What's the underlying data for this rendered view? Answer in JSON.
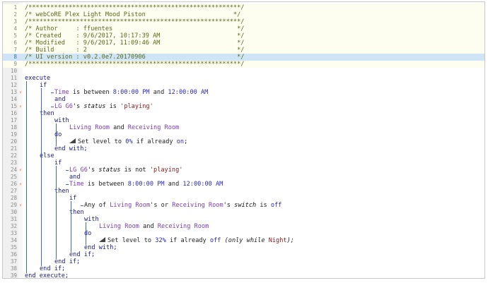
{
  "editor": {
    "highlighted_line": "8",
    "lines": [
      {
        "n": "1",
        "tokens": [
          {
            "t": "/**********************************************************/",
            "c": "c-comment"
          }
        ]
      },
      {
        "n": "2",
        "tokens": [
          {
            "t": "/* webCoRE Plex Light Mood Piston                        */",
            "c": "c-comment"
          }
        ]
      },
      {
        "n": "3",
        "tokens": [
          {
            "t": "/**********************************************************/",
            "c": "c-comment"
          }
        ]
      },
      {
        "n": "4",
        "tokens": [
          {
            "t": "/* Author     : ffuentes                                  */",
            "c": "c-comment"
          }
        ]
      },
      {
        "n": "5",
        "tokens": [
          {
            "t": "/* Created    : 9/6/2017, 10:17:39 AM                     */",
            "c": "c-comment"
          }
        ]
      },
      {
        "n": "6",
        "tokens": [
          {
            "t": "/* Modified   : 9/6/2017, 11:09:46 AM                     */",
            "c": "c-comment"
          }
        ]
      },
      {
        "n": "7",
        "tokens": [
          {
            "t": "/* Build      : 2                                         */",
            "c": "c-comment"
          }
        ]
      },
      {
        "n": "8",
        "tokens": [
          {
            "t": "/* UI version : v0.2.0e7.20170906                         */",
            "c": "c-comment"
          }
        ]
      },
      {
        "n": "9",
        "tokens": [
          {
            "t": "/**********************************************************/",
            "c": "c-comment"
          }
        ]
      },
      {
        "n": "10",
        "tokens": []
      },
      {
        "n": "11",
        "indent": 0,
        "tokens": [
          {
            "t": "execute",
            "c": "kw"
          }
        ]
      },
      {
        "n": "12",
        "indent": 1,
        "tokens": [
          {
            "t": "if",
            "c": "kw"
          }
        ]
      },
      {
        "n": "13",
        "indent": 2,
        "bolt": "⚡",
        "tokens": [
          {
            "t": "Time",
            "c": "dev"
          },
          {
            "t": " is between ",
            "c": "op"
          },
          {
            "t": "8:00:00 PM",
            "c": "val"
          },
          {
            "t": " and ",
            "c": "op"
          },
          {
            "t": "12:00:00 AM",
            "c": "val"
          }
        ]
      },
      {
        "n": "14",
        "indent": 2,
        "tokens": [
          {
            "t": "and",
            "c": "kw"
          }
        ]
      },
      {
        "n": "15",
        "indent": 2,
        "bolt": "⚡",
        "tokens": [
          {
            "t": "LG G6",
            "c": "dev"
          },
          {
            "t": "'s ",
            "c": "op"
          },
          {
            "t": "status",
            "c": "attr"
          },
          {
            "t": " is ",
            "c": "op"
          },
          {
            "t": "'playing'",
            "c": "str"
          }
        ]
      },
      {
        "n": "16",
        "indent": 1,
        "tokens": [
          {
            "t": "then",
            "c": "kw"
          }
        ]
      },
      {
        "n": "17",
        "indent": 2,
        "tokens": [
          {
            "t": "with",
            "c": "kw"
          }
        ]
      },
      {
        "n": "18",
        "indent": 3,
        "tokens": [
          {
            "t": "Living Room",
            "c": "dev"
          },
          {
            "t": " and ",
            "c": "op"
          },
          {
            "t": "Receiving Room",
            "c": "dev"
          }
        ]
      },
      {
        "n": "19",
        "indent": 2,
        "tokens": [
          {
            "t": "do",
            "c": "kw"
          }
        ]
      },
      {
        "n": "20",
        "indent": 3,
        "icon": true,
        "tokens": [
          {
            "t": "Set level to ",
            "c": "op"
          },
          {
            "t": "0%",
            "c": "val"
          },
          {
            "t": " if already ",
            "c": "op"
          },
          {
            "t": "on",
            "c": "val"
          },
          {
            "t": ";",
            "c": "op"
          }
        ]
      },
      {
        "n": "21",
        "indent": 2,
        "tokens": [
          {
            "t": "end with;",
            "c": "kw"
          }
        ]
      },
      {
        "n": "22",
        "indent": 1,
        "tokens": [
          {
            "t": "else",
            "c": "kw"
          }
        ]
      },
      {
        "n": "23",
        "indent": 2,
        "tokens": [
          {
            "t": "if",
            "c": "kw"
          }
        ]
      },
      {
        "n": "24",
        "indent": 3,
        "bolt": "⚡",
        "tokens": [
          {
            "t": "LG G6",
            "c": "dev"
          },
          {
            "t": "'s ",
            "c": "op"
          },
          {
            "t": "status",
            "c": "attr"
          },
          {
            "t": " is not ",
            "c": "op"
          },
          {
            "t": "'playing'",
            "c": "str"
          }
        ]
      },
      {
        "n": "25",
        "indent": 3,
        "tokens": [
          {
            "t": "and",
            "c": "kw"
          }
        ]
      },
      {
        "n": "26",
        "indent": 3,
        "bolt": "⚡",
        "tokens": [
          {
            "t": "Time",
            "c": "dev"
          },
          {
            "t": " is between ",
            "c": "op"
          },
          {
            "t": "8:00:00 PM",
            "c": "val"
          },
          {
            "t": " and ",
            "c": "op"
          },
          {
            "t": "12:00:00 AM",
            "c": "val"
          }
        ]
      },
      {
        "n": "27",
        "indent": 2,
        "tokens": [
          {
            "t": "then",
            "c": "kw"
          }
        ]
      },
      {
        "n": "28",
        "indent": 3,
        "tokens": [
          {
            "t": "if",
            "c": "kw"
          }
        ]
      },
      {
        "n": "29",
        "indent": 4,
        "bolt": "⚡",
        "tokens": [
          {
            "t": "Any of ",
            "c": "op"
          },
          {
            "t": "Living Room",
            "c": "dev"
          },
          {
            "t": "'s or ",
            "c": "op"
          },
          {
            "t": "Receiving Room",
            "c": "dev"
          },
          {
            "t": "'s ",
            "c": "op"
          },
          {
            "t": "switch",
            "c": "attr"
          },
          {
            "t": " is ",
            "c": "op"
          },
          {
            "t": "off",
            "c": "val"
          }
        ]
      },
      {
        "n": "30",
        "indent": 3,
        "tokens": [
          {
            "t": "then",
            "c": "kw"
          }
        ]
      },
      {
        "n": "31",
        "indent": 4,
        "tokens": [
          {
            "t": "with",
            "c": "kw"
          }
        ]
      },
      {
        "n": "32",
        "indent": 5,
        "tokens": [
          {
            "t": "Living Room",
            "c": "dev"
          },
          {
            "t": " and ",
            "c": "op"
          },
          {
            "t": "Receiving Room",
            "c": "dev"
          }
        ]
      },
      {
        "n": "33",
        "indent": 4,
        "tokens": [
          {
            "t": "do",
            "c": "kw"
          }
        ]
      },
      {
        "n": "34",
        "indent": 5,
        "icon": true,
        "tokens": [
          {
            "t": "Set level to ",
            "c": "op"
          },
          {
            "t": "32%",
            "c": "val"
          },
          {
            "t": " if already ",
            "c": "op"
          },
          {
            "t": "off",
            "c": "val"
          },
          {
            "t": " (only while ",
            "c": "note"
          },
          {
            "t": "Night",
            "c": "str"
          },
          {
            "t": ");",
            "c": "note"
          }
        ]
      },
      {
        "n": "35",
        "indent": 4,
        "tokens": [
          {
            "t": "end with;",
            "c": "kw"
          }
        ]
      },
      {
        "n": "36",
        "indent": 3,
        "tokens": [
          {
            "t": "end if;",
            "c": "kw"
          }
        ]
      },
      {
        "n": "37",
        "indent": 2,
        "tokens": [
          {
            "t": "end if;",
            "c": "kw"
          }
        ]
      },
      {
        "n": "38",
        "indent": 1,
        "tokens": [
          {
            "t": "end if;",
            "c": "kw"
          }
        ]
      },
      {
        "n": "39",
        "indent": 0,
        "tokens": [
          {
            "t": "end execute;",
            "c": "kw"
          }
        ]
      }
    ]
  },
  "colors": {
    "highlight": "#cfe5f7",
    "comment": "#5a6a1a",
    "keyword": "#1a1a8a",
    "device": "#7d3bb3",
    "value": "#2a2ab8",
    "string": "#8a1a1a",
    "guide": "#3f66c0",
    "bolt": "#e0712a"
  },
  "icons": {
    "trigger": "lightning-bolt-icon",
    "command": "signal-bars-icon"
  }
}
